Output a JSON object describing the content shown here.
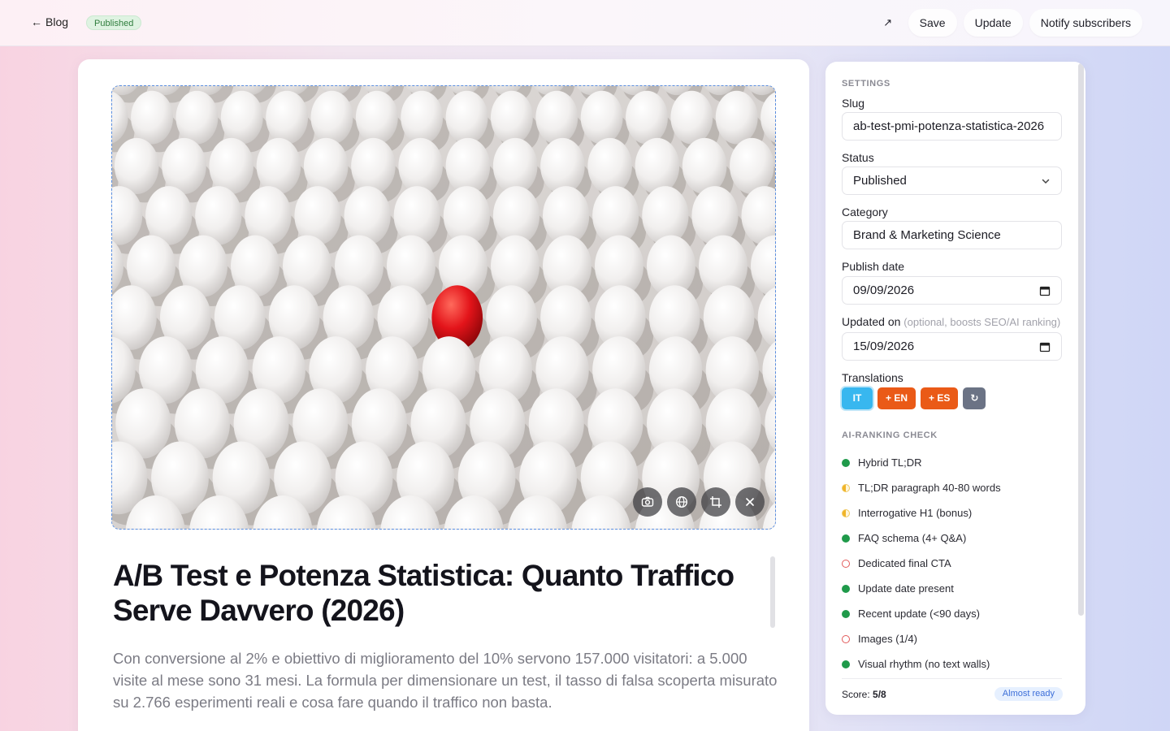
{
  "topbar": {
    "back_label": "Blog",
    "status_badge": "Published",
    "actions": {
      "open_label": "↗",
      "save_label": "Save",
      "update_label": "Update",
      "notify_label": "Notify subscribers"
    }
  },
  "post": {
    "title": "A/B Test e Potenza Statistica: Quanto Traffico Serve Davvero (2026)",
    "lede": "Con conversione al 2% e obiettivo di miglioramento del 10% servono 157.000 visitatori: a 5.000 visite al mese sono 31 mesi. La formula per dimensionare un test, il tasso di falsa scoperta misurato su 2.766 esperimenti reali e cosa fare quando il traffico non basta."
  },
  "settings": {
    "heading": "Settings",
    "slug_label": "Slug",
    "slug_value": "ab-test-pmi-potenza-statistica-2026",
    "status_label": "Status",
    "status_value": "Published",
    "category_label": "Category",
    "category_value": "Brand & Marketing Science",
    "publish_date_label": "Publish date",
    "publish_date_value": "09/09/2026",
    "updated_label": "Updated on",
    "updated_hint": "(optional, boosts SEO/AI ranking)",
    "updated_value": "15/09/2026",
    "translations_label": "Translations",
    "translations": {
      "it": "IT",
      "en": "+ EN",
      "es": "+ ES",
      "refresh": "↻"
    },
    "ai_heading": "AI-ranking check",
    "checks": [
      {
        "label": "Hybrid TL;DR",
        "state": "ok"
      },
      {
        "label": "TL;DR paragraph 40-80 words",
        "state": "warn"
      },
      {
        "label": "Interrogative H1 (bonus)",
        "state": "warn"
      },
      {
        "label": "FAQ schema (4+ Q&A)",
        "state": "ok"
      },
      {
        "label": "Dedicated final CTA",
        "state": "bad"
      },
      {
        "label": "Update date present",
        "state": "ok"
      },
      {
        "label": "Recent update (<90 days)",
        "state": "ok"
      },
      {
        "label": "Images (1/4)",
        "state": "bad"
      },
      {
        "label": "Visual rhythm (no text walls)",
        "state": "ok"
      }
    ],
    "score_label": "Score:",
    "score_value": "5/8",
    "score_badge": "Almost ready"
  },
  "colors": {
    "accent_blue": "#38b7ef",
    "translate_orange": "#ea5a17",
    "ok_green": "#1f9a4a",
    "bad_red": "#e25a5a"
  }
}
